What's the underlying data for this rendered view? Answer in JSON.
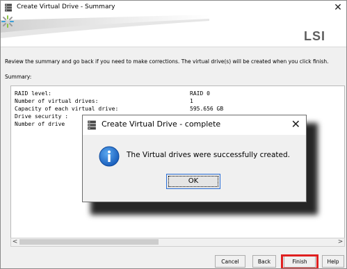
{
  "window": {
    "title": "Create Virtual Drive - Summary",
    "close_glyph": "✕"
  },
  "brand": {
    "logo_text": "LSI"
  },
  "intro_text": "Review the summary and go back if you need to make corrections. The virtual drive(s) will be created when you click finish.",
  "summary": {
    "label": "Summary:",
    "rows": [
      {
        "key": "RAID level:",
        "value": "RAID 0"
      },
      {
        "key": "Number of virtual drives:",
        "value": "1"
      },
      {
        "key": "Capacity of each virtual drive:",
        "value": "595.656 GB"
      },
      {
        "key": "Drive security :",
        "value": ""
      },
      {
        "key": "Number of drive",
        "value": ""
      }
    ]
  },
  "scrollbar": {
    "left_arrow": "<",
    "right_arrow": ">"
  },
  "buttons": {
    "cancel": "Cancel",
    "back": "Back",
    "finish": "Finish",
    "help": "Help"
  },
  "modal": {
    "title": "Create Virtual Drive - complete",
    "close_glyph": "✕",
    "message": "The Virtual drives were successfully created.",
    "ok_label": "OK"
  },
  "colors": {
    "highlight": "#e02020",
    "info_blue": "#1a6fd6",
    "ok_border": "#2a6fd8"
  }
}
